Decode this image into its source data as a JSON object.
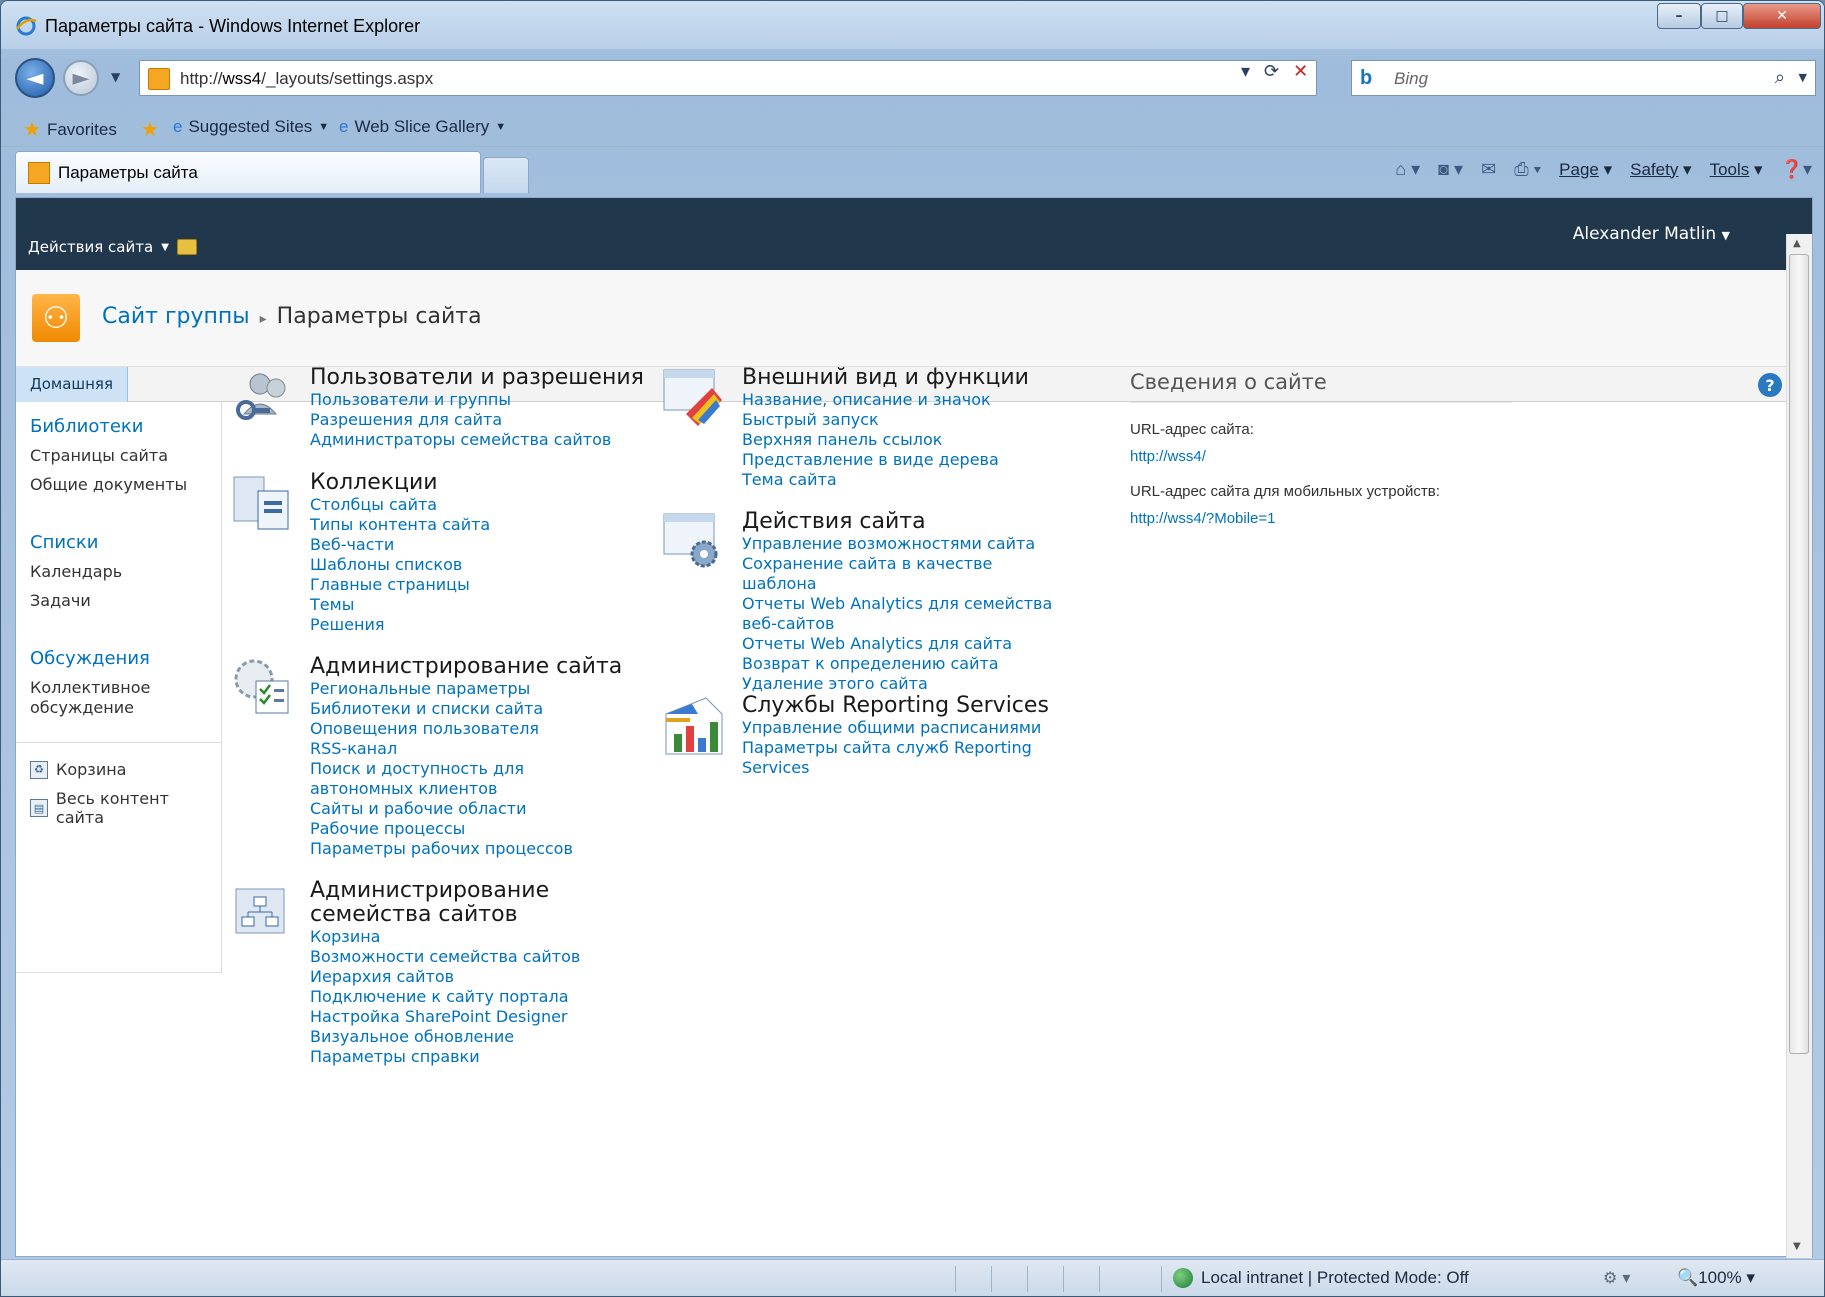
{
  "window": {
    "title": "Параметры сайта - Windows Internet Explorer",
    "controls": {
      "minimize": "–",
      "maximize": "□",
      "close": "✕"
    }
  },
  "address": {
    "url_prefix": "http://",
    "url_host": "wss4",
    "url_path": "/_layouts/settings.aspx",
    "search_placeholder": "Bing"
  },
  "favorites_bar": {
    "favorites": "Favorites",
    "suggested": "Suggested Sites",
    "gallery": "Web Slice Gallery"
  },
  "tab": {
    "label": "Параметры сайта"
  },
  "command_bar": {
    "page": "Page",
    "safety": "Safety",
    "tools": "Tools"
  },
  "sp": {
    "site_actions": "Действия сайта",
    "user": "Alexander Matlin",
    "breadcrumb": {
      "site": "Сайт группы",
      "sep": "▸",
      "page": "Параметры сайта"
    },
    "topnav_home": "Домашняя"
  },
  "quicklaunch": {
    "libraries": {
      "head": "Библиотеки",
      "items": [
        "Страницы сайта",
        "Общие документы"
      ]
    },
    "lists": {
      "head": "Списки",
      "items": [
        "Календарь",
        "Задачи"
      ]
    },
    "discussions": {
      "head": "Обсуждения",
      "items": [
        "Коллективное обсуждение"
      ]
    },
    "recycle": "Корзина",
    "all_content": "Весь контент сайта"
  },
  "sections": {
    "users": {
      "title": "Пользователи и разрешения",
      "links": [
        "Пользователи и группы",
        "Разрешения для сайта",
        "Администраторы семейства сайтов"
      ]
    },
    "galleries": {
      "title": "Коллекции",
      "links": [
        "Столбцы сайта",
        "Типы контента сайта",
        "Веб-части",
        "Шаблоны списков",
        "Главные страницы",
        "Темы",
        "Решения"
      ]
    },
    "site_admin": {
      "title": "Администрирование сайта",
      "links": [
        "Региональные параметры",
        "Библиотеки и списки сайта",
        "Оповещения пользователя",
        "RSS-канал",
        "Поиск и доступность для автономных клиентов",
        "Сайты и рабочие области",
        "Рабочие процессы",
        "Параметры рабочих процессов"
      ]
    },
    "collection_admin": {
      "title": "Администрирование семейства сайтов",
      "links": [
        "Корзина",
        "Возможности семейства сайтов",
        "Иерархия сайтов",
        "Подключение к сайту портала",
        "Настройка SharePoint Designer",
        "Визуальное обновление",
        "Параметры справки"
      ]
    },
    "look_feel": {
      "title": "Внешний вид и функции",
      "links": [
        "Название, описание и значок",
        "Быстрый запуск",
        "Верхняя панель ссылок",
        "Представление в виде дерева",
        "Тема сайта"
      ]
    },
    "site_actions": {
      "title": "Действия сайта",
      "links": [
        "Управление возможностями сайта",
        "Сохранение сайта в качестве шаблона",
        "Отчеты Web Analytics для семейства веб-сайтов",
        "Отчеты Web Analytics для сайта",
        "Возврат к определению сайта",
        "Удаление этого сайта"
      ]
    },
    "reporting": {
      "title": "Службы Reporting Services",
      "links": [
        "Управление общими расписаниями",
        "Параметры сайта служб Reporting Services"
      ]
    }
  },
  "site_info": {
    "title": "Сведения о сайте",
    "url_label": "URL-адрес сайта:",
    "url_value": "http://wss4/",
    "mobile_label": "URL-адрес сайта для мобильных устройств:",
    "mobile_value": "http://wss4/?Mobile=1"
  },
  "status": {
    "zone": "Local intranet | Protected Mode: Off",
    "zoom": "100%"
  }
}
